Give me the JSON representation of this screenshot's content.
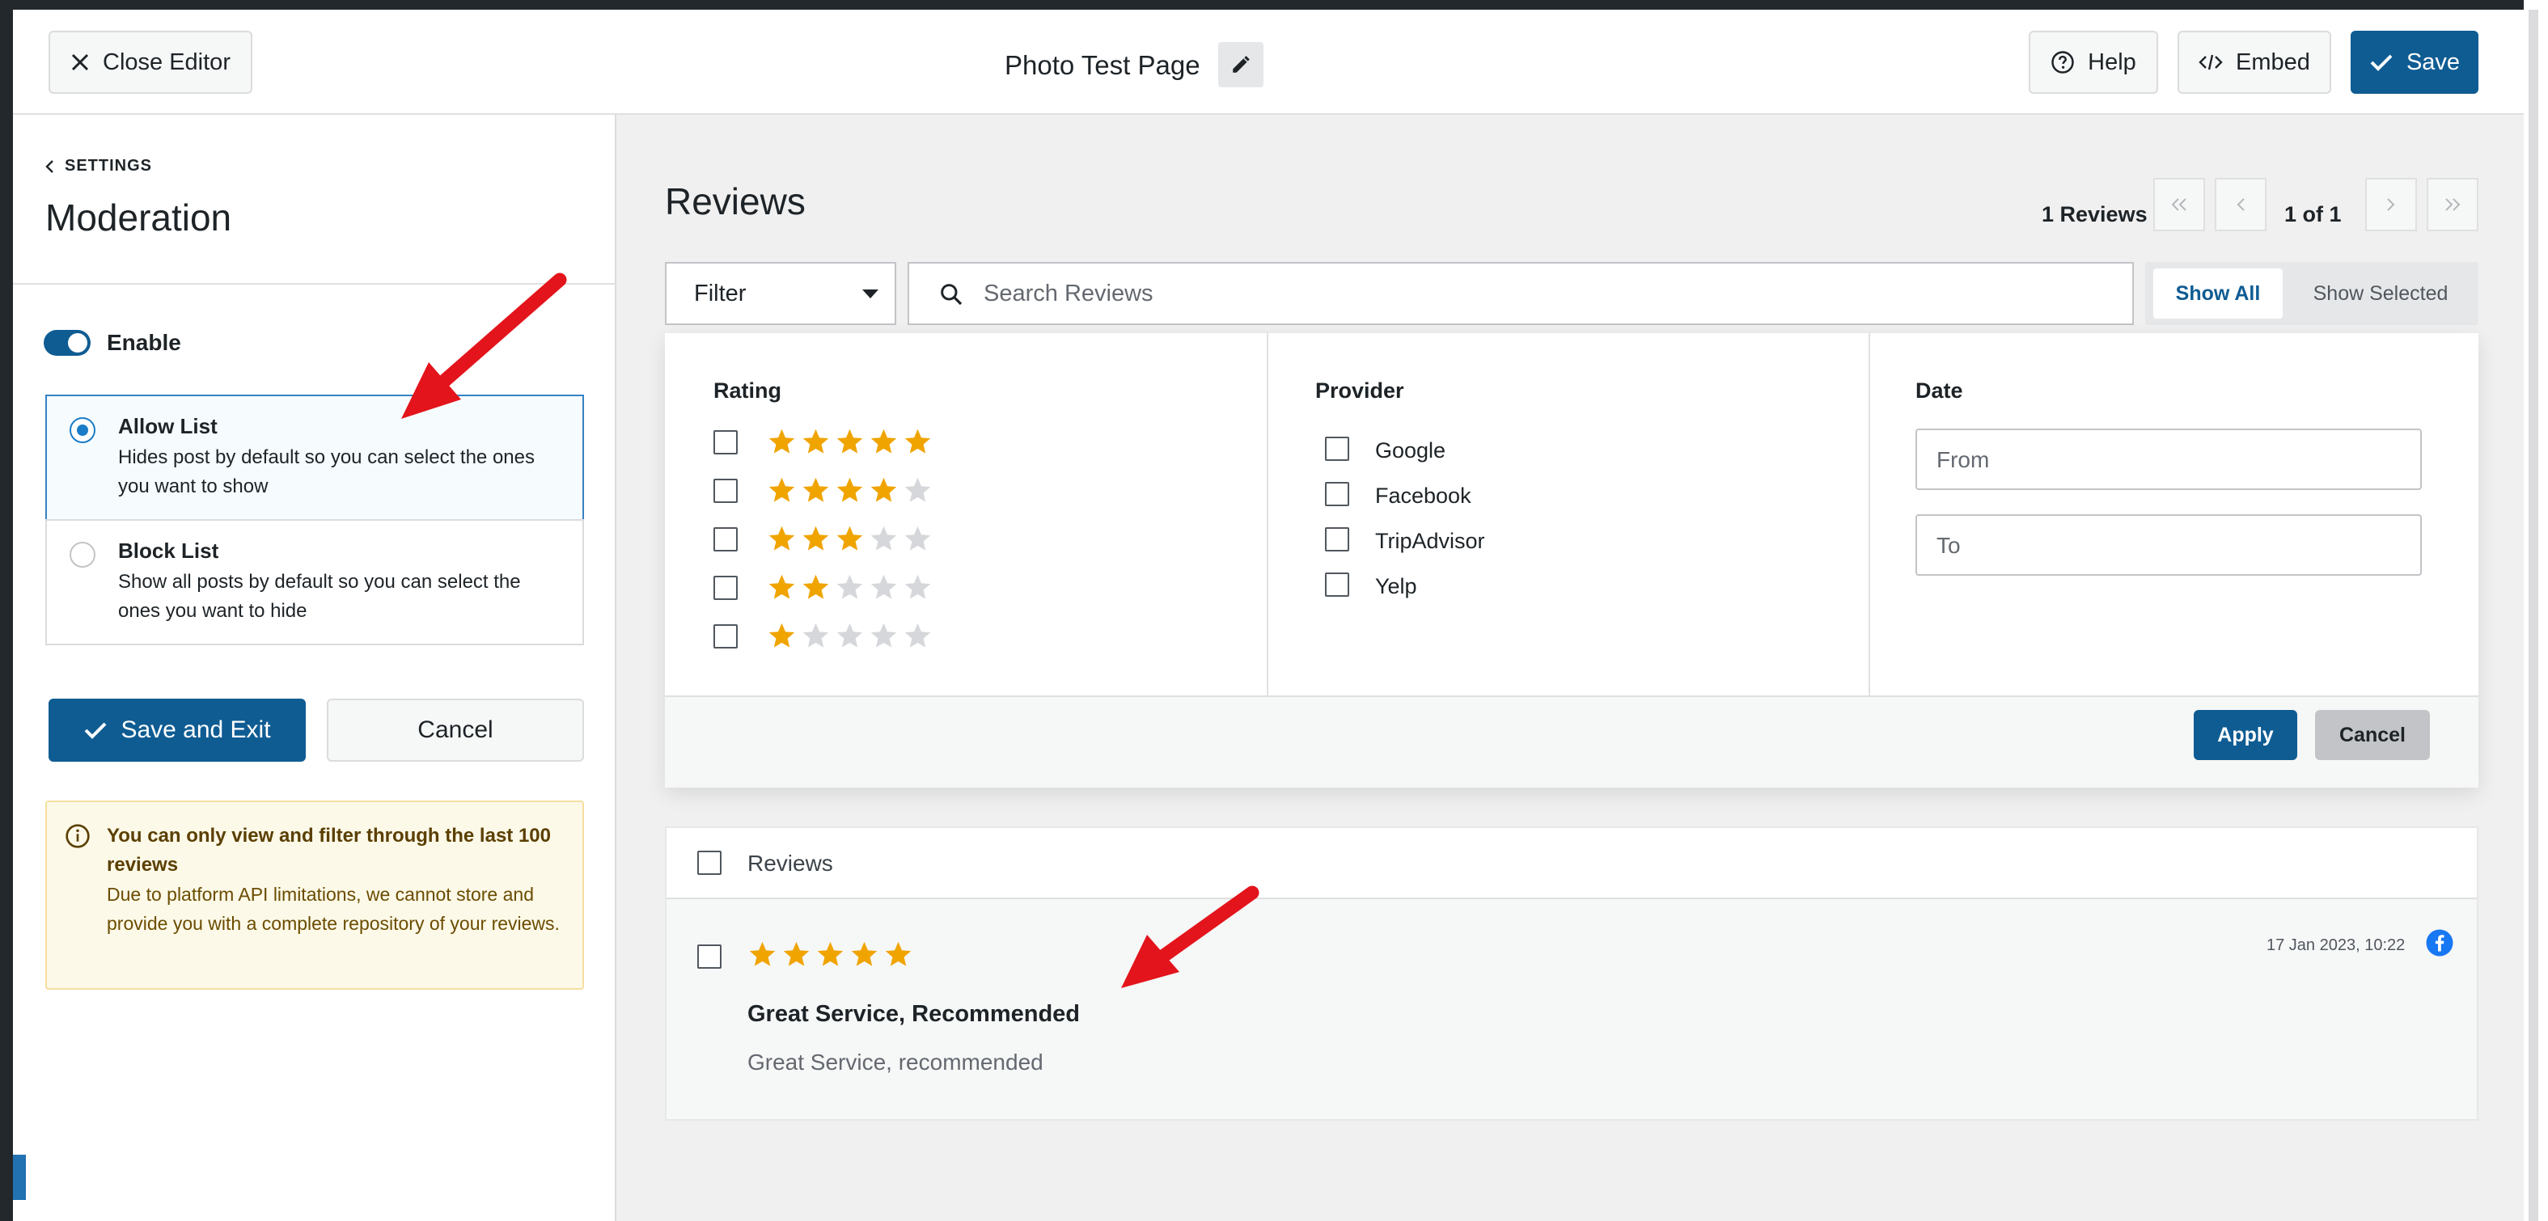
{
  "header": {
    "close_label": "Close Editor",
    "page_title": "Photo Test Page",
    "help_label": "Help",
    "embed_label": "Embed",
    "save_label": "Save"
  },
  "sidebar": {
    "back_label": "SETTINGS",
    "title": "Moderation",
    "enable_label": "Enable",
    "enabled": true,
    "options": [
      {
        "title": "Allow List",
        "desc": "Hides post by default so you can select the ones you want to show",
        "selected": true
      },
      {
        "title": "Block List",
        "desc": "Show all posts by default so you can select the ones you want to hide",
        "selected": false
      }
    ],
    "save_exit_label": "Save and Exit",
    "cancel_label": "Cancel",
    "notice": {
      "title": "You can only view and filter through the last 100 reviews",
      "body": "Due to platform API limitations, we cannot store and provide you with a complete repository of your reviews."
    }
  },
  "main": {
    "title": "Reviews",
    "review_count": "1 Reviews",
    "page_indicator": "1 of 1",
    "filter_label": "Filter",
    "search_placeholder": "Search Reviews",
    "show_all_label": "Show All",
    "show_selected_label": "Show Selected",
    "filter_panel": {
      "rating_heading": "Rating",
      "rating_rows": [
        5,
        4,
        3,
        2,
        1
      ],
      "provider_heading": "Provider",
      "providers": [
        "Google",
        "Facebook",
        "TripAdvisor",
        "Yelp"
      ],
      "date_heading": "Date",
      "from_placeholder": "From",
      "to_placeholder": "To",
      "apply_label": "Apply",
      "cancel_label": "Cancel"
    },
    "list": {
      "header_label": "Reviews",
      "reviews": [
        {
          "rating": 5,
          "date": "17 Jan 2023, 10:22",
          "provider_icon": "facebook-icon",
          "title": "Great Service, Recommended",
          "text": "Great Service, recommended"
        }
      ]
    }
  },
  "colors": {
    "primary": "#0f5c93",
    "star_on": "#f0a400",
    "star_off": "#d5d7da",
    "notice_bg": "#fcf9e8",
    "facebook": "#1877f2",
    "arrow": "#e3141b"
  }
}
